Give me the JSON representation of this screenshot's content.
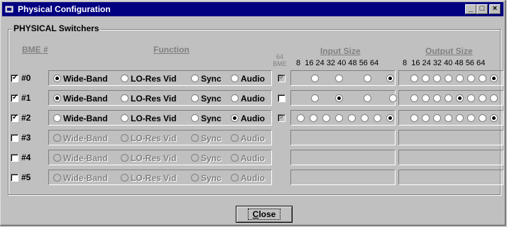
{
  "window": {
    "title": "Physical Configuration",
    "buttons": [
      "_",
      "□",
      "×"
    ]
  },
  "group_title": "PHYSICAL Switchers",
  "headers": {
    "bme": "BME #",
    "function": "Function",
    "bme64_a": "64",
    "bme64_b": "BME",
    "input_size": "Input Size",
    "output_size": "Output Size",
    "size_ticks": "8  16 24 32 40 48 56 64"
  },
  "function_options": [
    "Wide-Band",
    "LO-Res Vid",
    "Sync",
    "Audio"
  ],
  "rows": [
    {
      "label": "#0",
      "checked": true,
      "enabled": true,
      "function": 0,
      "bme64": true,
      "input": 7,
      "output": 7
    },
    {
      "label": "#1",
      "checked": true,
      "enabled": true,
      "function": 0,
      "bme64": false,
      "input": 2,
      "output": 4
    },
    {
      "label": "#2",
      "checked": true,
      "enabled": true,
      "function": 3,
      "bme64": true,
      "input": 7,
      "output": 7
    },
    {
      "label": "#3",
      "checked": false,
      "enabled": false,
      "function": null,
      "bme64": null,
      "input": null,
      "output": null
    },
    {
      "label": "#4",
      "checked": false,
      "enabled": false,
      "function": null,
      "bme64": null,
      "input": null,
      "output": null
    },
    {
      "label": "#5",
      "checked": false,
      "enabled": false,
      "function": null,
      "bme64": null,
      "input": null,
      "output": null
    }
  ],
  "close_button": {
    "mnemonic": "C",
    "rest": "lose"
  }
}
